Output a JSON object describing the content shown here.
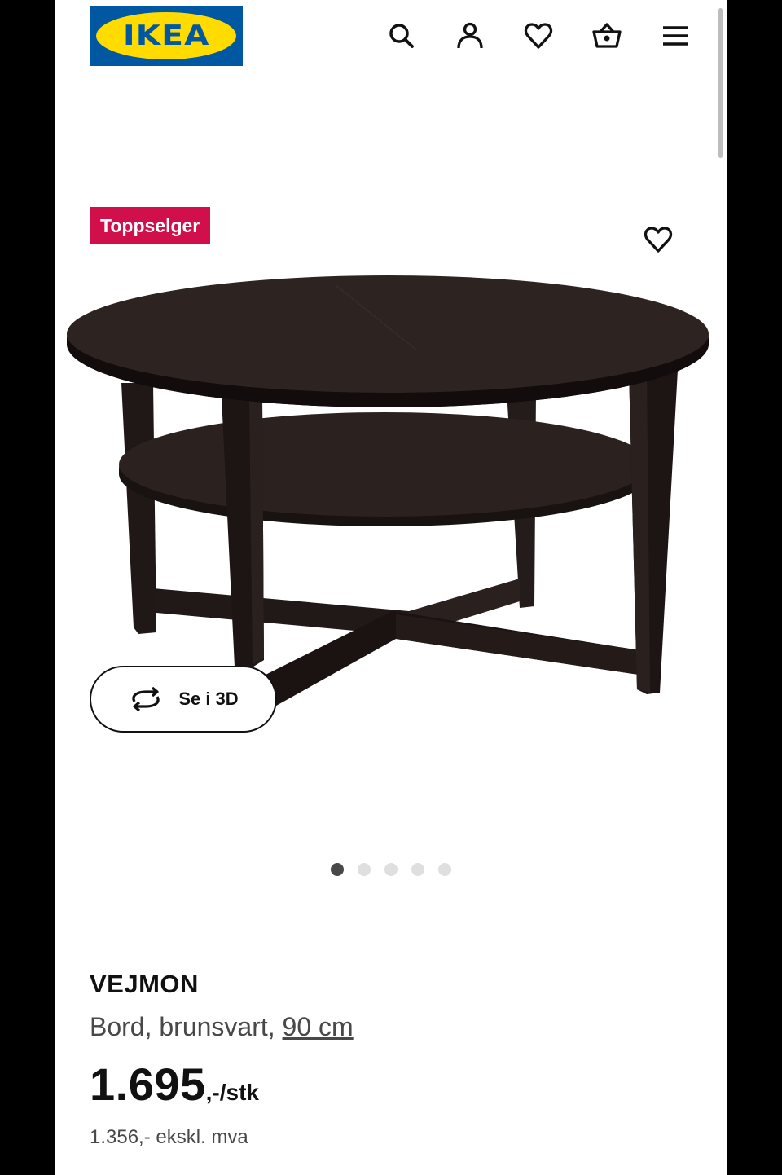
{
  "header": {
    "logo_text": "IKEA",
    "icons": [
      "search-icon",
      "account-icon",
      "heart-icon",
      "basket-icon",
      "menu-icon"
    ]
  },
  "product": {
    "badge": "Toppselger",
    "view_3d_label": "Se i 3D",
    "image_count": 5,
    "active_image": 1,
    "name": "VEJMON",
    "description": "Bord, brunsvart,",
    "size": "90 cm",
    "price": "1.695",
    "price_suffix": ",-/stk",
    "price_excl": "1.356,- ekskl. mva"
  },
  "colors": {
    "brand_blue": "#0058a3",
    "brand_yellow": "#ffdb00",
    "badge_red": "#d10f4b"
  }
}
